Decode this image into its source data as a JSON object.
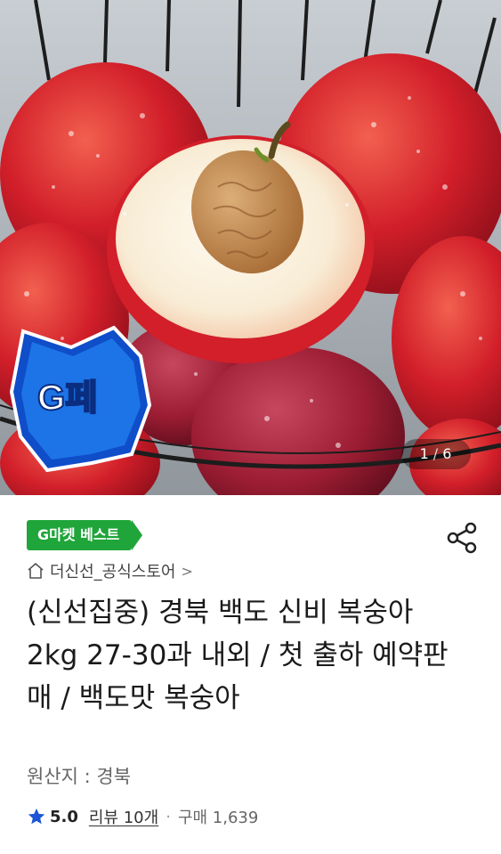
{
  "hero": {
    "pager_current": "1",
    "pager_separator": "/",
    "pager_total": "6",
    "badge_text": "G페"
  },
  "product": {
    "tag": "G마켓 베스트",
    "store_name": "더신선_공식스토어",
    "store_chevron": ">",
    "title": "(신선집중) 경북 백도 신비 복숭아 2kg 27-30과 내외 / 첫 출하 예약판매 / 백도맛 복숭아",
    "origin": "원산지 : 경북",
    "rating": "5.0",
    "review_label": "리뷰 10개",
    "separator": "·",
    "purchase_label": "구매 1,639"
  },
  "colors": {
    "tag_green": "#1fa53a",
    "star_blue": "#1a56d6",
    "badge_blue": "#1d74e6"
  },
  "icons": {
    "share": "share-icon",
    "home": "home-icon",
    "star": "star-icon"
  }
}
